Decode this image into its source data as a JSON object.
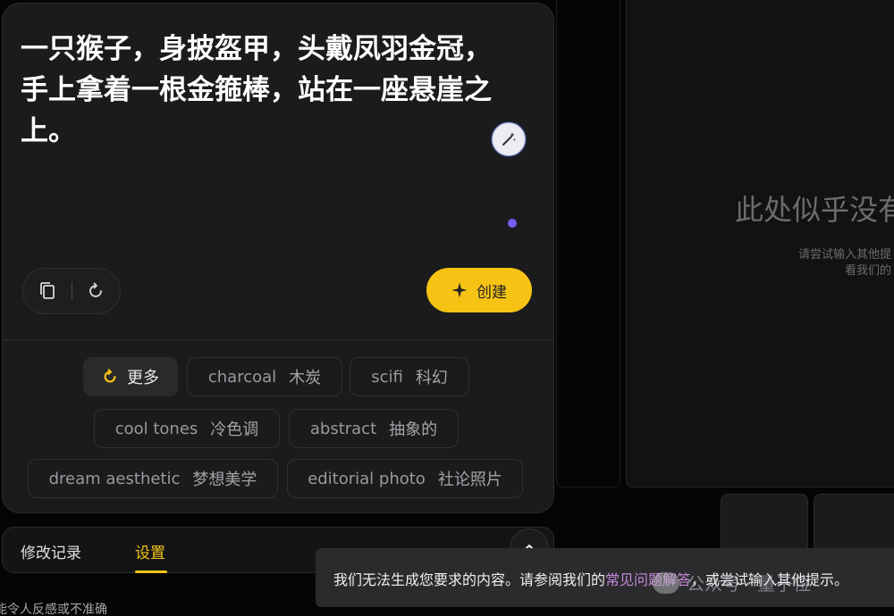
{
  "prompt": {
    "text": "一只猴子，身披盔甲，头戴凤羽金冠，\n手上拿着一根金箍棒，站在一座悬崖之\n上。"
  },
  "actions": {
    "create_label": "创建"
  },
  "suggestions": {
    "more_label": "更多",
    "chips": [
      {
        "en": "charcoal",
        "zh": "木炭"
      },
      {
        "en": "scifi",
        "zh": "科幻"
      },
      {
        "en": "cool tones",
        "zh": "冷色调"
      },
      {
        "en": "abstract",
        "zh": "抽象的"
      },
      {
        "en": "dream aesthetic",
        "zh": "梦想美学"
      },
      {
        "en": "editorial photo",
        "zh": "社论照片"
      }
    ]
  },
  "tabs": [
    {
      "label": "修改记录",
      "active": false
    },
    {
      "label": "设置",
      "active": true
    }
  ],
  "footer_note": "能令人反感或不准确",
  "empty_state": {
    "title": "此处似乎没有",
    "line1": "请尝试输入其他提",
    "line2": "看我们的"
  },
  "toast": {
    "prefix": "我们无法生成您要求的内容。请参阅我们的",
    "link": "常见问题解答",
    "suffix": "，或尝试输入其他提示。"
  },
  "watermark": "公众号 · 量子位",
  "colors": {
    "accent_yellow": "#f6c315",
    "indicator_purple": "#7a5cf0",
    "link_pink": "#c58ad9"
  },
  "icons": {
    "magic": "magic-wand-icon",
    "copy": "copy-icon",
    "reset": "refresh-icon",
    "create": "sparkle-icon",
    "more": "refresh-icon",
    "collapse": "chevron-up-icon"
  }
}
